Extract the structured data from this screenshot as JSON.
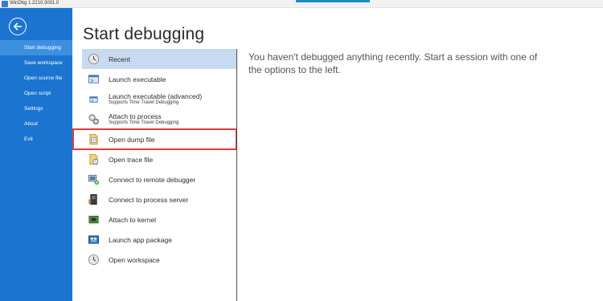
{
  "window": {
    "title": "WinDbg 1.2210.3001.0"
  },
  "sidebar": {
    "back_icon": "back-arrow-icon",
    "items": [
      {
        "label": "Start debugging",
        "active": true
      },
      {
        "label": "Save workspace"
      },
      {
        "label": "Open source file"
      },
      {
        "label": "Open script"
      },
      {
        "label": "Settings"
      },
      {
        "label": "About"
      },
      {
        "label": "Exit"
      }
    ]
  },
  "main": {
    "title": "Start debugging",
    "message": "You haven't debugged anything recently. Start a session with one of the options to the left.",
    "options": [
      {
        "label": "Recent",
        "sub": "",
        "icon": "clock-icon",
        "active": true
      },
      {
        "label": "Launch executable",
        "sub": "",
        "icon": "executable-icon"
      },
      {
        "label": "Launch executable (advanced)",
        "sub": "Supports Time Travel Debugging",
        "icon": "executable-advanced-icon"
      },
      {
        "label": "Attach to process",
        "sub": "Supports Time Travel Debugging",
        "icon": "gears-icon"
      },
      {
        "label": "Open dump file",
        "sub": "",
        "icon": "dump-file-icon",
        "highlighted": true
      },
      {
        "label": "Open trace file",
        "sub": "",
        "icon": "trace-file-icon"
      },
      {
        "label": "Connect to remote debugger",
        "sub": "",
        "icon": "remote-debugger-icon"
      },
      {
        "label": "Connect to process server",
        "sub": "",
        "icon": "process-server-icon"
      },
      {
        "label": "Attach to kernel",
        "sub": "",
        "icon": "chip-icon"
      },
      {
        "label": "Launch app package",
        "sub": "",
        "icon": "app-package-icon"
      },
      {
        "label": "Open workspace",
        "sub": "",
        "icon": "workspace-clock-icon"
      }
    ]
  },
  "colors": {
    "sidebar": "#1b75d0",
    "sidebar_active": "#3d8fe0",
    "option_active": "#c7daf1",
    "highlight_border": "#e23a3a"
  }
}
